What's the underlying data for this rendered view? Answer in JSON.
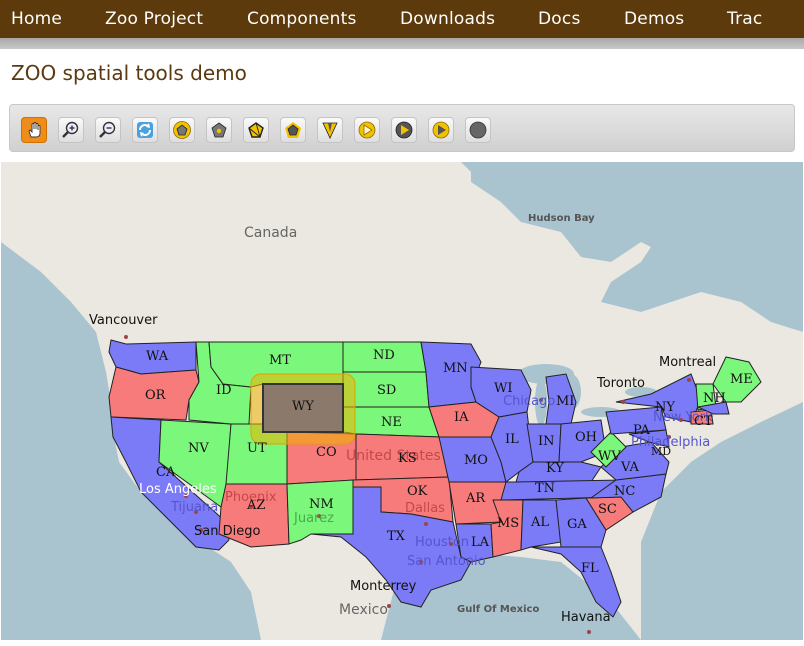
{
  "nav": {
    "items": [
      "Home",
      "Zoo Project",
      "Components",
      "Downloads",
      "Docs",
      "Demos",
      "Trac"
    ]
  },
  "page": {
    "title": "ZOO spatial tools demo"
  },
  "toolbar": {
    "tools": [
      {
        "name": "pan-hand-icon",
        "active": true
      },
      {
        "name": "zoom-in-icon"
      },
      {
        "name": "zoom-out-icon"
      },
      {
        "name": "refresh-icon"
      },
      {
        "name": "buffer-polygon-icon"
      },
      {
        "name": "centroid-polygon-icon"
      },
      {
        "name": "boundary-polygon-icon"
      },
      {
        "name": "convex-hull-icon"
      },
      {
        "name": "simplify-icon"
      },
      {
        "name": "union-icon"
      },
      {
        "name": "intersection-icon"
      },
      {
        "name": "difference-icon"
      },
      {
        "name": "sym-difference-icon"
      }
    ]
  },
  "map": {
    "colors": {
      "ocean": "#a9c3cf",
      "land": "#eae8e1",
      "blue_state": "#7b7bf7",
      "green_state": "#7bf77b",
      "red_state": "#f77b7b",
      "selection": "#f0b400",
      "selected_state": "#8b7a6b"
    },
    "regions": {
      "canada": "Canada",
      "hudson_bay": "Hudson Bay",
      "mexico": "Mexico",
      "gulf": "Gulf Of Mexico",
      "united_states": "United States"
    },
    "cities": {
      "vancouver": "Vancouver",
      "montreal": "Montreal",
      "toronto": "Toronto",
      "chicago": "Chicago",
      "new_york": "New York",
      "philadelphia": "Philadelphia",
      "los_angeles": "Los Angeles",
      "tijuana": "Tijuana",
      "san_diego": "San Diego",
      "phoenix": "Phoenix",
      "juarez": "Juarez",
      "dallas": "Dallas",
      "houston": "Houston",
      "san_antonio": "San Antonio",
      "monterrey": "Monterrey",
      "havana": "Havana"
    },
    "states": {
      "WA": "WA",
      "OR": "OR",
      "CA": "CA",
      "NV": "NV",
      "ID": "ID",
      "MT": "MT",
      "WY": "WY",
      "UT": "UT",
      "AZ": "AZ",
      "CO": "CO",
      "NM": "NM",
      "ND": "ND",
      "SD": "SD",
      "NE": "NE",
      "KS": "KS",
      "OK": "OK",
      "TX": "TX",
      "MN": "MN",
      "IA": "IA",
      "MO": "MO",
      "AR": "AR",
      "LA": "LA",
      "WI": "WI",
      "IL": "IL",
      "MI": "MI",
      "IN": "IN",
      "OH": "OH",
      "KY": "KY",
      "TN": "TN",
      "MS": "MS",
      "AL": "AL",
      "GA": "GA",
      "FL": "FL",
      "SC": "SC",
      "NC": "NC",
      "VA": "VA",
      "WV": "WV",
      "PA": "PA",
      "NY": "NY",
      "ME": "ME",
      "NH": "NH",
      "CT": "CT",
      "MD": "MD"
    }
  }
}
